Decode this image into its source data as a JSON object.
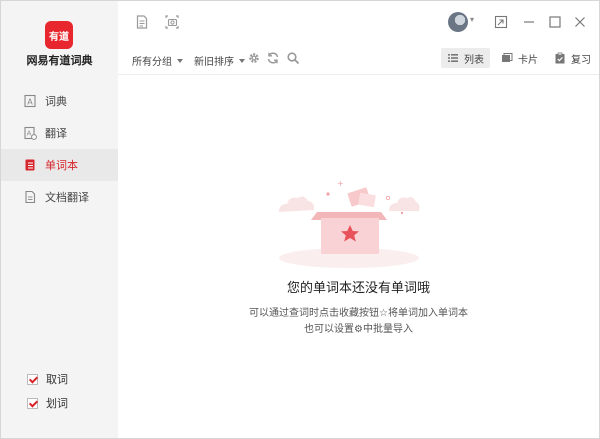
{
  "app": {
    "logo_text": "有道",
    "name": "网易有道词典"
  },
  "sidebar": {
    "items": [
      {
        "label": "词典",
        "icon": "dictionary-icon",
        "active": false
      },
      {
        "label": "翻译",
        "icon": "translate-icon",
        "active": false
      },
      {
        "label": "单词本",
        "icon": "wordbook-icon",
        "active": true
      },
      {
        "label": "文档翻译",
        "icon": "document-icon",
        "active": false
      }
    ],
    "options": [
      {
        "label": "取词",
        "checked": true
      },
      {
        "label": "划词",
        "checked": true
      }
    ]
  },
  "toolbar": {
    "group_filter": "所有分组",
    "sort_order": "新旧排序",
    "view_list": "列表",
    "view_card": "卡片",
    "review": "复习"
  },
  "empty_state": {
    "title": "您的单词本还没有单词哦",
    "line1": "可以通过查词时点击收藏按钮☆将单词加入单词本",
    "line2": "也可以设置⚙中批量导入"
  },
  "colors": {
    "accent": "#d6262d",
    "sidebar_bg": "#f4f4f4"
  }
}
